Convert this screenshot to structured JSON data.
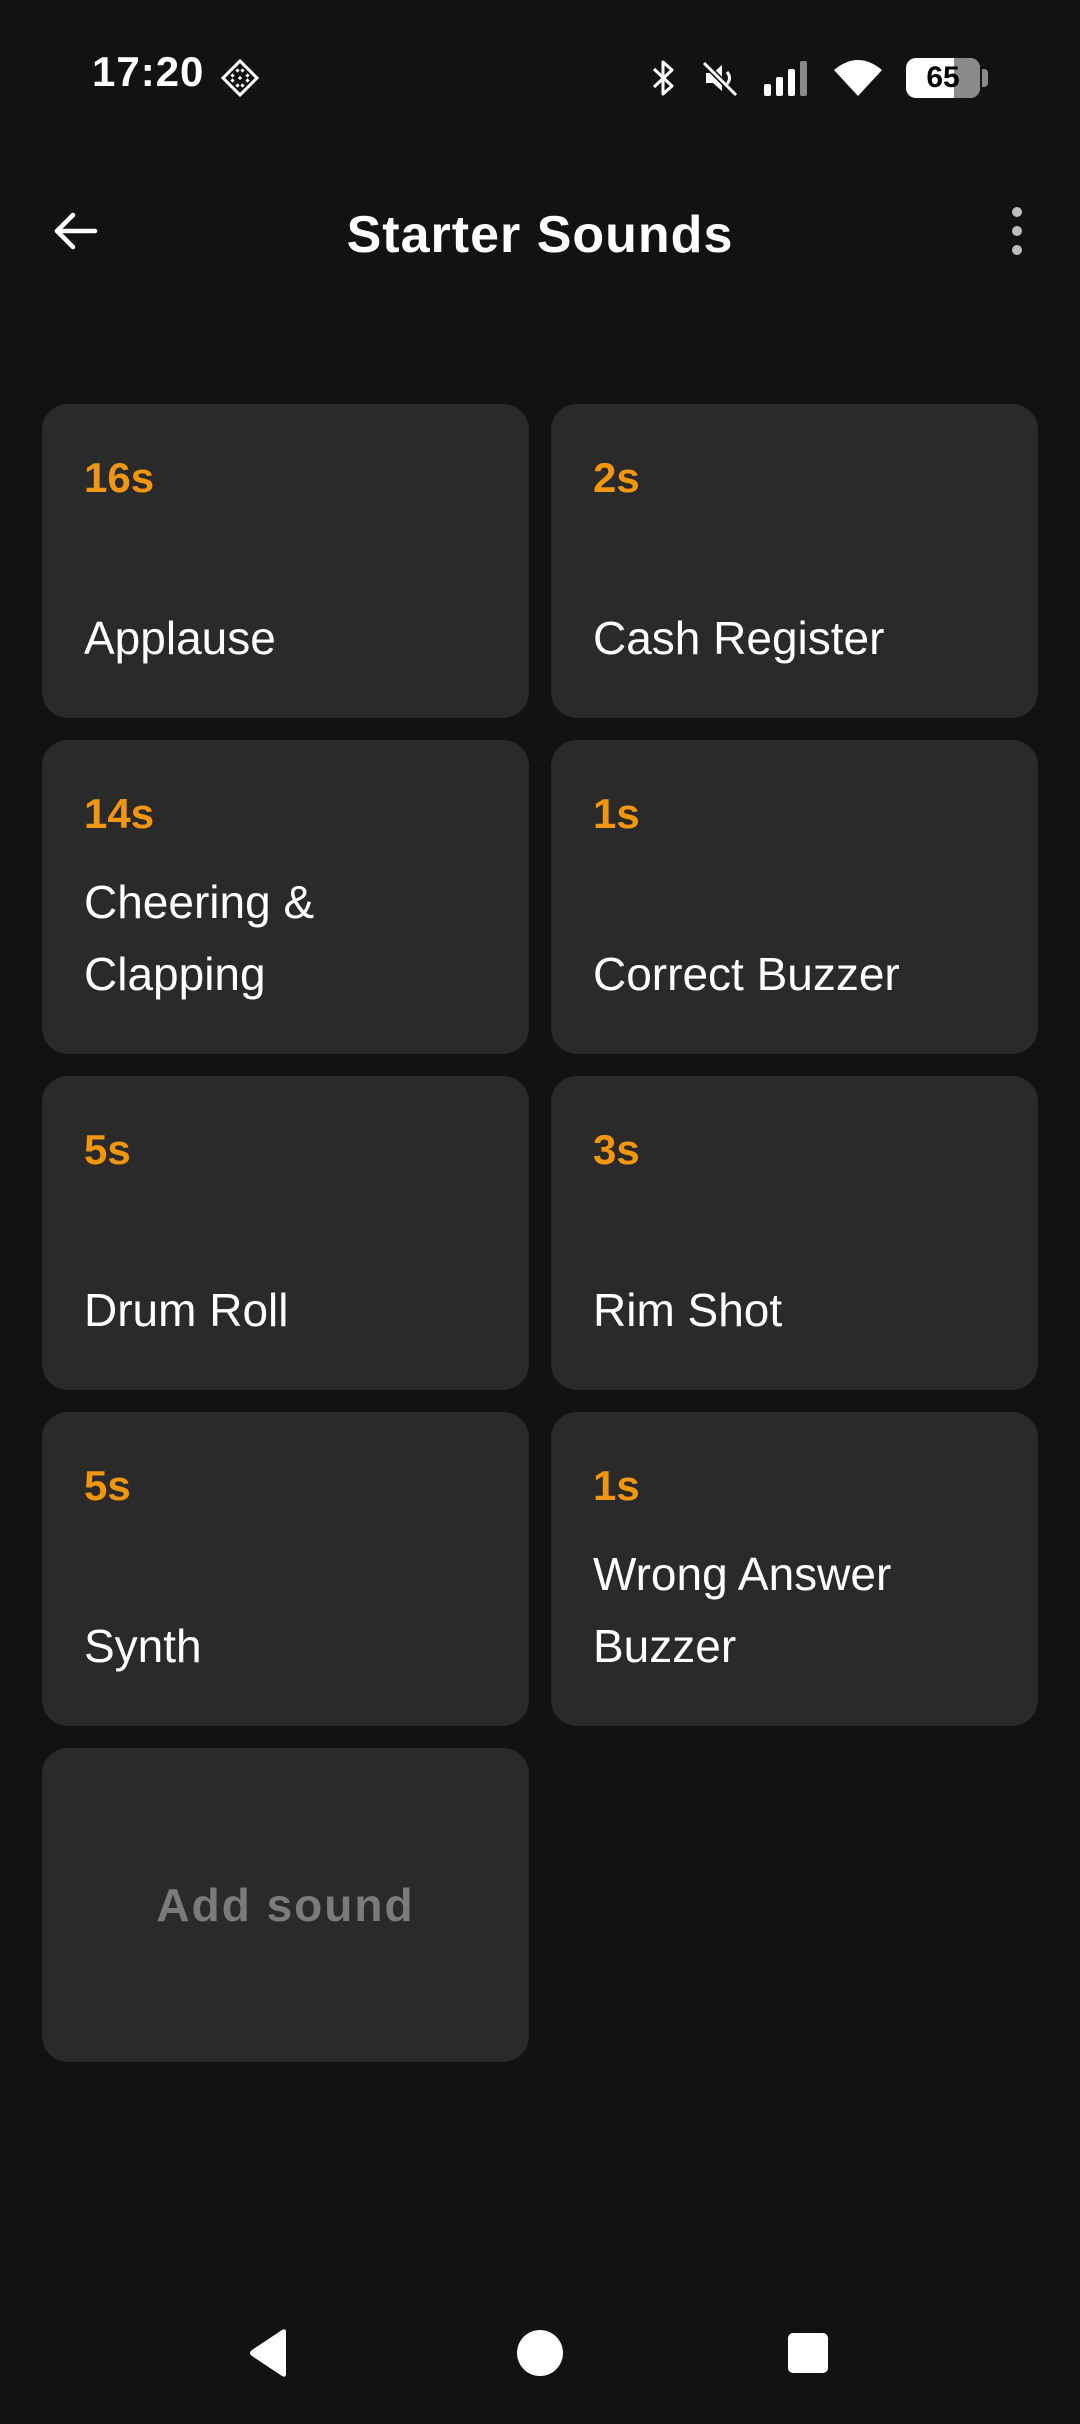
{
  "status_bar": {
    "time": "17:20",
    "battery": "65",
    "battery_level": 0.65,
    "icons": [
      "diamond-app-icon",
      "bluetooth-icon",
      "mute-icon",
      "signal-icon",
      "wifi-icon",
      "battery-icon"
    ]
  },
  "app_bar": {
    "title": "Starter Sounds",
    "back_icon": "arrow-left-icon",
    "menu_icon": "more-vertical-icon"
  },
  "sounds": [
    {
      "duration": "16s",
      "name": "Applause"
    },
    {
      "duration": "2s",
      "name": "Cash Register"
    },
    {
      "duration": "14s",
      "name": "Cheering & Clapping"
    },
    {
      "duration": "1s",
      "name": "Correct Buzzer"
    },
    {
      "duration": "5s",
      "name": "Drum Roll"
    },
    {
      "duration": "3s",
      "name": "Rim Shot"
    },
    {
      "duration": "5s",
      "name": "Synth"
    },
    {
      "duration": "1s",
      "name": "Wrong Answer Buzzer"
    }
  ],
  "add_sound_label": "Add sound",
  "colors": {
    "background": "#121212",
    "tile": "#2a2a2a",
    "accent": "#f2960f",
    "add_text": "#7b7b7b"
  },
  "nav_bar": {
    "icons": [
      "back-triangle-icon",
      "home-circle-icon",
      "recents-square-icon"
    ]
  }
}
